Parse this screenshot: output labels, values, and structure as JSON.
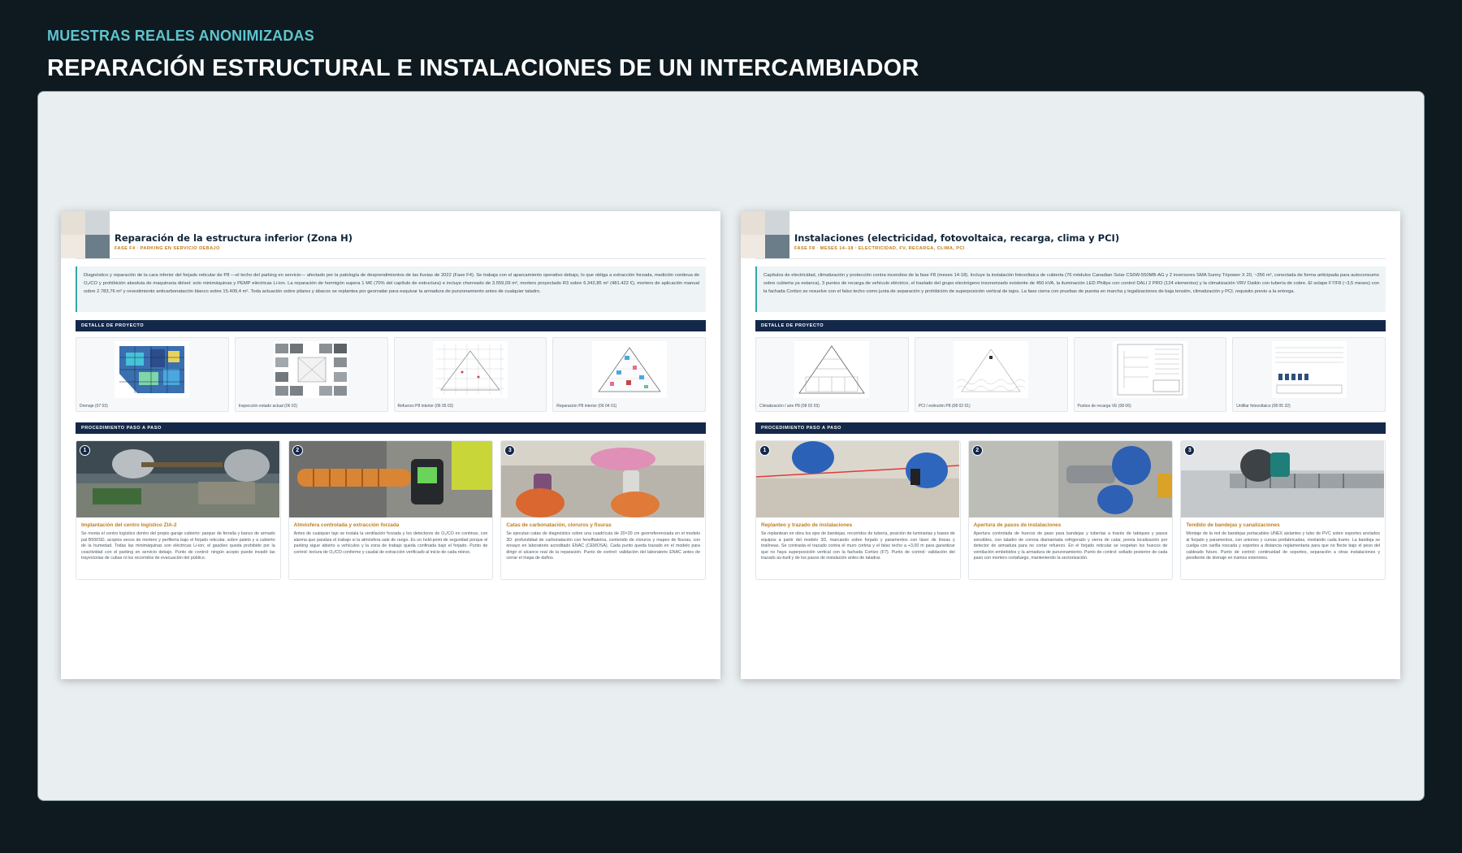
{
  "header": {
    "eyebrow": "MUESTRAS REALES ANONIMIZADAS",
    "title": "REPARACIÓN ESTRUCTURAL E INSTALACIONES DE UN INTERCAMBIADOR"
  },
  "sheets": [
    {
      "title": "Reparación de la estructura inferior (Zona H)",
      "subtitle": "FASE F4 · PARKING EN SERVICIO DEBAJO",
      "intro": "Diagnóstico y reparación de la cara inferior del forjado reticular de P8 —el techo del parking en servicio— afectado por la patología de desprendimientos de las lluvias de 2022 (Fase F4). Se trabaja con el aparcamiento operativo debajo, lo que obliga a extracción forzada, medición continua de O₂/CO y prohibición absoluta de maquinaria diésel: solo minimáquinas y PEMP eléctricas Li-ion. La reparación de hormigón supera 1 M€ (70% del capítulo de estructura) e incluye chorreado de 3.559,09 m², mortero proyectado R3 sobre 6.342,85 m² (481.422 €), mortero de aplicación manual sobre 2.783,76 m² y revestimiento anticarbonatación blanco sobre 15.409,4 m². Toda actuación sobre pilares y ábacos se replantea por georradar para esquivar la armadura de punzonamiento antes de cualquier taladro.",
      "detail_label": "DETALLE DE PROYECTO",
      "thumbs": [
        {
          "caption": "Drenaje (07 03)",
          "kind": "heatmap"
        },
        {
          "caption": "Inspección estado actual (06 02)",
          "kind": "photos"
        },
        {
          "caption": "Refuerzo P8 interior (06 05 02)",
          "kind": "grid"
        },
        {
          "caption": "Reparación P8 interior (06 04 01)",
          "kind": "colored"
        }
      ],
      "steps_label": "PROCEDIMIENTO PASO A PASO",
      "steps": [
        {
          "num": "1",
          "title": "Implantación del centro logístico ZIA-2",
          "body": "Se monta el centro logístico dentro del propio garaje cubierto: parque de ferralla y banco de armado pal B500SD, acopios secos de mortero y perfilería bajo el forjado reticular, sobre palets y a cubierto de la humedad. Todas las minimáquinas son eléctricas Li-ion; el gasóleo queda prohibido por la coactividad con el parking en servicio debajo. Punto de control: ningún acopio puede invadir las trayectorias de cubas ni los recorridos de evacuación del público.",
          "photo": "warehouse"
        },
        {
          "num": "2",
          "title": "Atmósfera controlada y extracción forzada",
          "body": "Antes de cualquier tajo se instala la ventilación forzada y los detectores de O₂/CO en continuo, con alarma que paraliza el trabajo si la atmósfera sale de rango. Es un hold-point de seguridad porque el parking sigue abierto a vehículos y la zona de trabajo queda confinada bajo el forjado. Punto de control: lectura de O₂/CO conforme y caudal de extracción verificado al inicio de cada relevo.",
          "photo": "detector"
        },
        {
          "num": "3",
          "title": "Catas de carbonatación, cloruros y fisuras",
          "body": "Se ejecutan catas de diagnóstico sobre una cuadrícula de 20×20 cm georreferenciada en el modelo 3D: profundidad de carbonatación con fenolftaleína, contenido de cloruros y mapeo de fisuras, con ensayo en laboratorio acreditado ENAC (CEMOSA). Cada punto queda trazado en el modelo para dirigir el alcance real de la reparación. Punto de control: validación del laboratorio ENAC antes de cerrar el mapa de daños.",
          "photo": "spray"
        }
      ]
    },
    {
      "title": "Instalaciones (electricidad, fotovoltaica, recarga, clima y PCI)",
      "subtitle": "FASE F8 · MESES 14–18 · ELECTRICIDAD, FV, RECARGA, CLIMA, PCI",
      "intro": "Capítulos de electricidad, climatización y protección contra incendios de la fase F8 (meses 14-18). Incluye la instalación fotovoltaica de cubierta (76 módulos Canadian Solar CS6W-550MB-AG y 2 inversores SMA Sunny Tripower X 20, ~356 m², conectada de forma anticipada para autoconsumo sobre cubierta ya estanca), 3 puntos de recarga de vehículo eléctrico, el traslado del grupo electrógeno insonorizado existente de 450 kVA, la iluminación LED Philips con control DALI 2 PRO (124 elementos) y la climatización VRV Daikin con tubería de cobre. El solape F7/F8 (~3,5 meses) con la fachada Cortizo se resuelve con el falso techo como junta de separación y prohibición de superposición vertical de tajos. La fase cierra con pruebas de puesta en marcha y legalizaciones de baja tensión, climatización y PCI, requisito previo a la entrega.",
      "detail_label": "DETALLE DE PROYECTO",
      "thumbs": [
        {
          "caption": "Climatización / aire P8 (08 02 03)",
          "kind": "plan"
        },
        {
          "caption": "PCI / extinción P8 (08 02 01)",
          "kind": "plan2"
        },
        {
          "caption": "Puntos de recarga VE (08 06)",
          "kind": "schematic"
        },
        {
          "caption": "Unifilar fotovoltaico (08 05 32)",
          "kind": "unifilar"
        }
      ],
      "steps_label": "PROCEDIMIENTO PASO A PASO",
      "steps": [
        {
          "num": "1",
          "title": "Replanteo y trazado de instalaciones",
          "body": "Se replantean en obra los ejes de bandejas, recorridos de tubería, posición de luminarias y bases de equipos a partir del modelo 3D, marcando sobre forjado y paramentos con láser de líneas y tiralíneas. Se contrasta el trazado contra el muro cortina y el falso techo a +3,00 m para garantizar que no haya superposición vertical con la fachada Cortizo (F7). Punto de control: validación del trazado as-built y de los pasos de instalación antes de taladrar.",
          "photo": "laser"
        },
        {
          "num": "2",
          "title": "Apertura de pasos de instalaciones",
          "body": "Apertura controlada de huecos de paso para bandejas y tuberías a través de tabiques y pasos sensibles, con taladro de corona diamantada refrigerado y sierra de calar, previa localización por detector de armadura para no cortar refuerzo. En el forjado reticular se respetan los huecos de ventilación embebidos y la armadura de punzonamiento. Punto de control: sellado posterior de cada paso con mortero cortafuego, manteniendo la sectorización.",
          "photo": "drill"
        },
        {
          "num": "3",
          "title": "Tendido de bandejas y canalizaciones",
          "body": "Montaje de la red de bandejas portacables UNEX aislantes y tubo de PVC sobre soportes anclados al forjado y paramentos, con uniones y curvas prefabricadas, nivelando cada tramo. La bandeja se cuelga con varilla roscada y soportes a distancia reglamentaria para que no flecte bajo el peso del cableado futuro. Punto de control: continuidad de soportes, separación a otras instalaciones y pendiente de drenaje en tramos exteriores.",
          "photo": "tray"
        }
      ]
    }
  ]
}
